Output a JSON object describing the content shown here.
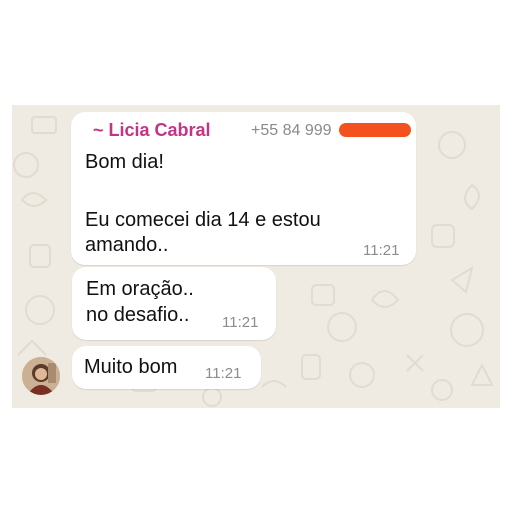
{
  "conversation": {
    "messages": [
      {
        "sender": "~ Licia Cabral",
        "phone": "+55 84 999",
        "line1": "Bom dia!",
        "line2": "Eu comecei dia 14 e estou",
        "line3": "amando..",
        "time": "11:21"
      },
      {
        "line1": "Em oração..",
        "line2": "no desafio..",
        "time": "11:21"
      },
      {
        "line1": "Muito bom",
        "time": "11:21"
      }
    ]
  },
  "colors": {
    "background": "#efeae2",
    "bubble": "#ffffff",
    "sender_name": "#c13584",
    "redaction": "#f4511e"
  }
}
